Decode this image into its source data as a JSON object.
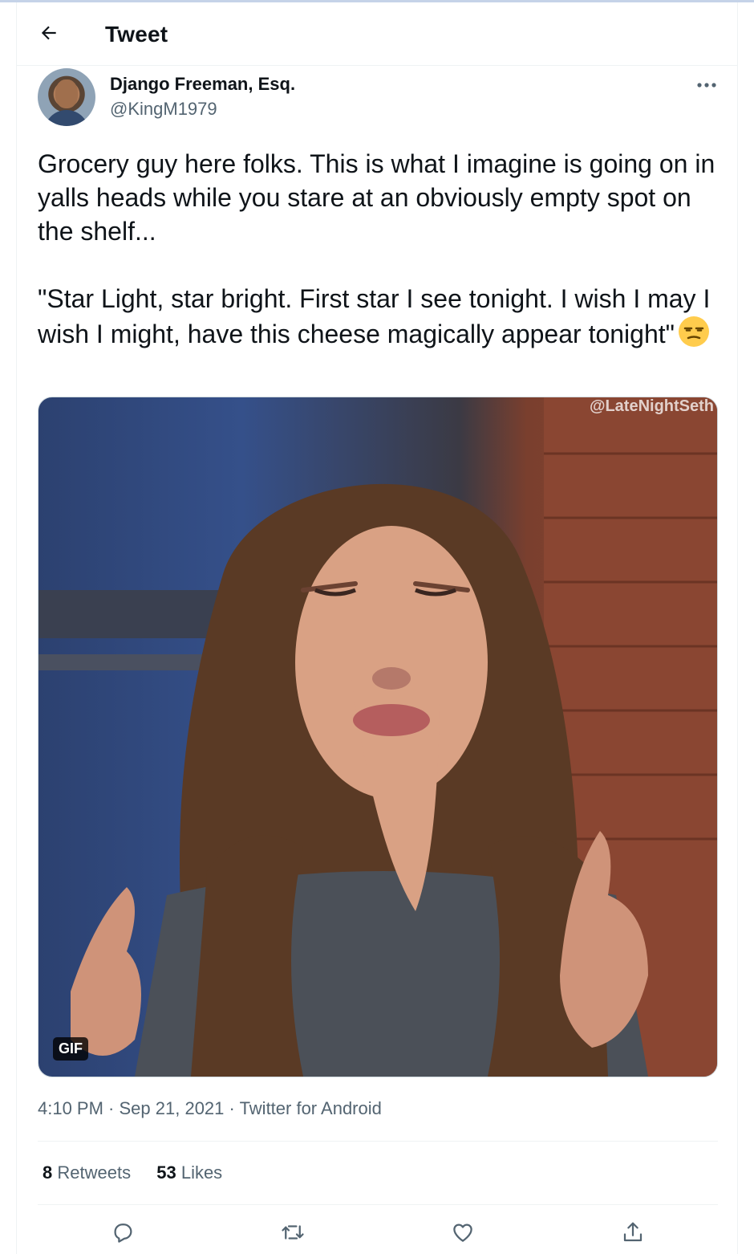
{
  "header": {
    "title": "Tweet"
  },
  "author": {
    "name": "Django Freeman, Esq.",
    "handle": "@KingM1979"
  },
  "tweet": {
    "text": "Grocery guy here folks. This is what I imagine is going on in yalls heads while you stare at an obviously empty spot on the shelf...\n\n\"Star Light, star bright. First star I see tonight. I wish I may I wish I might, have this cheese magically appear tonight\"",
    "emoji": "unamused-face-icon"
  },
  "media": {
    "watermark": "@LateNightSeth",
    "badge": "GIF"
  },
  "meta": {
    "time": "4:10 PM",
    "sep": " · ",
    "date": "Sep 21, 2021",
    "source": "Twitter for Android"
  },
  "stats": {
    "retweets_count": "8",
    "retweets_label": "Retweets",
    "likes_count": "53",
    "likes_label": "Likes"
  },
  "actions": [
    "reply-icon",
    "retweet-icon",
    "like-icon",
    "share-icon"
  ],
  "colors": {
    "secondary_text": "#536471",
    "divider": "#eff3f4",
    "text": "#0f1419"
  }
}
